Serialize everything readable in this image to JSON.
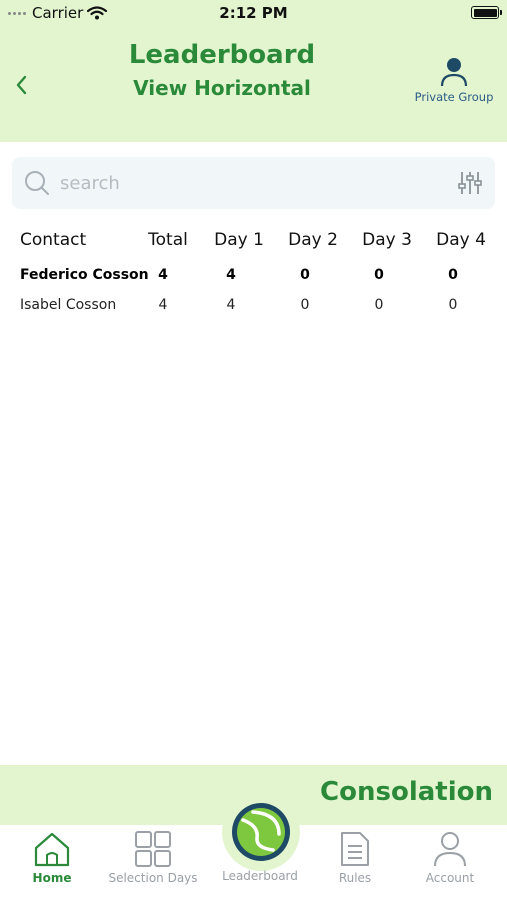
{
  "status_bar": {
    "carrier": "Carrier",
    "time": "2:12 PM"
  },
  "header": {
    "title": "Leaderboard",
    "subtitle": "View Horizontal",
    "private_group_label": "Private Group"
  },
  "search": {
    "placeholder": "search",
    "value": ""
  },
  "table": {
    "columns": [
      "Contact",
      "Total",
      "Day 1",
      "Day 2",
      "Day 3",
      "Day 4"
    ],
    "rows": [
      {
        "contact": "Federico Cosson",
        "total": "4",
        "day1": "4",
        "day2": "0",
        "day3": "0",
        "day4": "0",
        "bold": true
      },
      {
        "contact": "Isabel Cosson",
        "total": "4",
        "day1": "4",
        "day2": "0",
        "day3": "0",
        "day4": "0",
        "bold": false
      }
    ]
  },
  "banner": {
    "label": "Consolation"
  },
  "tabbar": {
    "home": "Home",
    "selection_days": "Selection Days",
    "leaderboard": "Leaderboard",
    "rules": "Rules",
    "account": "Account",
    "active": "home"
  },
  "colors": {
    "accent_green": "#2a8a3a",
    "header_bg": "#e3f5cf",
    "private_group_blue": "#2b5b86",
    "tab_inactive": "#9aa0a6",
    "ball_yellow": "#7ec83f",
    "ball_ring": "#1e4a66"
  },
  "icons": {
    "back": "chevron-left-icon",
    "private_group": "person-icon",
    "search": "search-icon",
    "filter": "sliders-icon",
    "home": "home-icon",
    "selection_days": "grid-icon",
    "leaderboard": "tennis-ball-icon",
    "rules": "document-icon",
    "account": "person-icon"
  }
}
